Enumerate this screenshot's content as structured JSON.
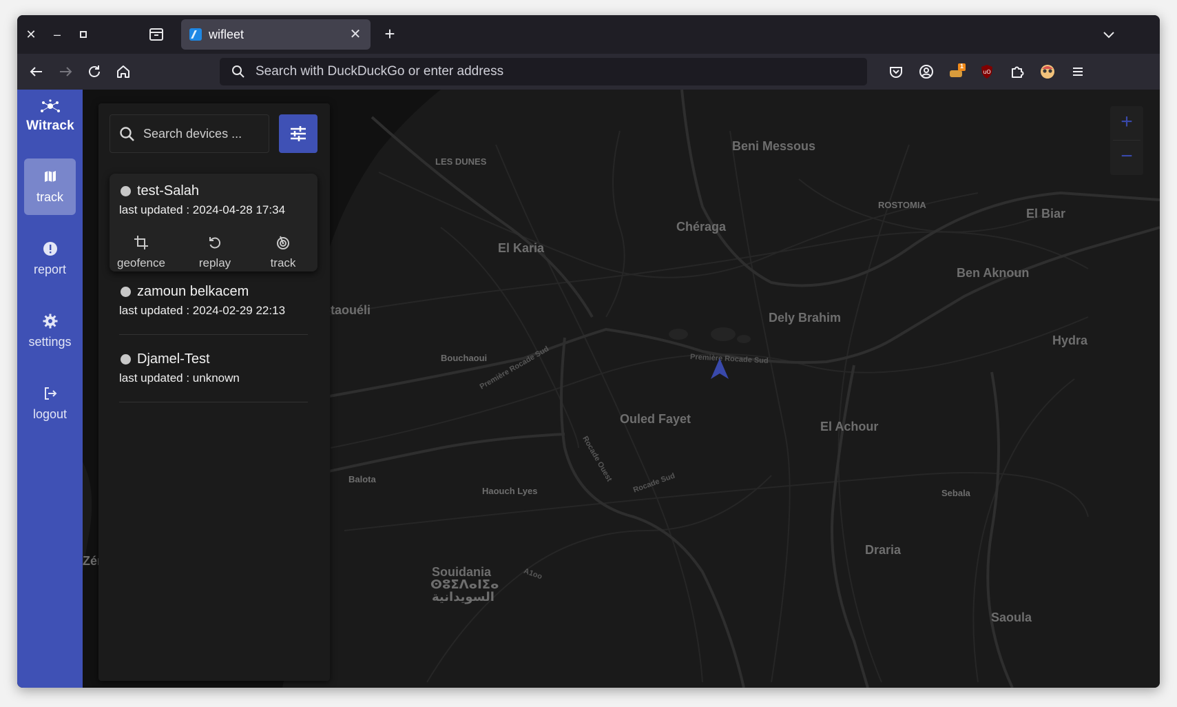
{
  "browser": {
    "tab_title": "wifleet",
    "address_placeholder": "Search with DuckDuckGo or enter address",
    "extension_badge": "1"
  },
  "app": {
    "logo_text": "Witrack",
    "nav": [
      {
        "label": "track",
        "icon": "map-icon",
        "active": true
      },
      {
        "label": "report",
        "icon": "alert-circle-icon",
        "active": false
      },
      {
        "label": "settings",
        "icon": "gear-icon",
        "active": false
      },
      {
        "label": "logout",
        "icon": "logout-icon",
        "active": false
      }
    ],
    "search_placeholder": "Search devices ...",
    "devices": [
      {
        "name": "test-Salah",
        "updated": "last updated : 2024-04-28 17:34",
        "status_color": "#c8c8c8",
        "actions": [
          {
            "label": "geofence",
            "icon": "crop-icon"
          },
          {
            "label": "replay",
            "icon": "replay-icon"
          },
          {
            "label": "track",
            "icon": "track-icon"
          }
        ]
      },
      {
        "name": "zamoun belkacem",
        "updated": "last updated : 2024-02-29 22:13",
        "status_color": "#c8c8c8"
      },
      {
        "name": "Djamel-Test",
        "updated": "last updated : unknown",
        "status_color": "#c8c8c8"
      }
    ],
    "accent_color": "#3f51b5"
  },
  "map": {
    "zoom_in": "+",
    "zoom_out": "−",
    "places": [
      {
        "name": "Beni Messous",
        "kind": "big"
      },
      {
        "name": "LES DUNES",
        "kind": "small"
      },
      {
        "name": "ROSTOMIA",
        "kind": "small"
      },
      {
        "name": "El Biar",
        "kind": "big"
      },
      {
        "name": "Chéraga",
        "kind": "big"
      },
      {
        "name": "El Karia",
        "kind": "big"
      },
      {
        "name": "Ben Aknoun",
        "kind": "big"
      },
      {
        "name": "Staouéli",
        "kind": "big"
      },
      {
        "name": "Dely Brahim",
        "kind": "big"
      },
      {
        "name": "Hydra",
        "kind": "big"
      },
      {
        "name": "Bouchaoui",
        "kind": "small"
      },
      {
        "name": "Première Rocade Sud",
        "kind": "tiny"
      },
      {
        "name": "Ouled Fayet",
        "kind": "big"
      },
      {
        "name": "El Achour",
        "kind": "big"
      },
      {
        "name": "Balota",
        "kind": "small"
      },
      {
        "name": "Haouch Lyes",
        "kind": "small"
      },
      {
        "name": "Sebala",
        "kind": "small"
      },
      {
        "name": "Draria",
        "kind": "big"
      },
      {
        "name": "Souidania",
        "kind": "big"
      },
      {
        "name": "ⵙⵓⵉⴷⴰⵏⵉⴰ",
        "kind": "big"
      },
      {
        "name": "السويدانية",
        "kind": "big"
      },
      {
        "name": "Saoula",
        "kind": "big"
      },
      {
        "name": "Rocade Ouest",
        "kind": "tiny"
      },
      {
        "name": "Rocade Sud",
        "kind": "tiny"
      },
      {
        "name": "A1oo",
        "kind": "tiny"
      },
      {
        "name": "Zér",
        "kind": "big"
      },
      {
        "name": "Première Rocade Sud",
        "kind": "tiny"
      }
    ]
  }
}
